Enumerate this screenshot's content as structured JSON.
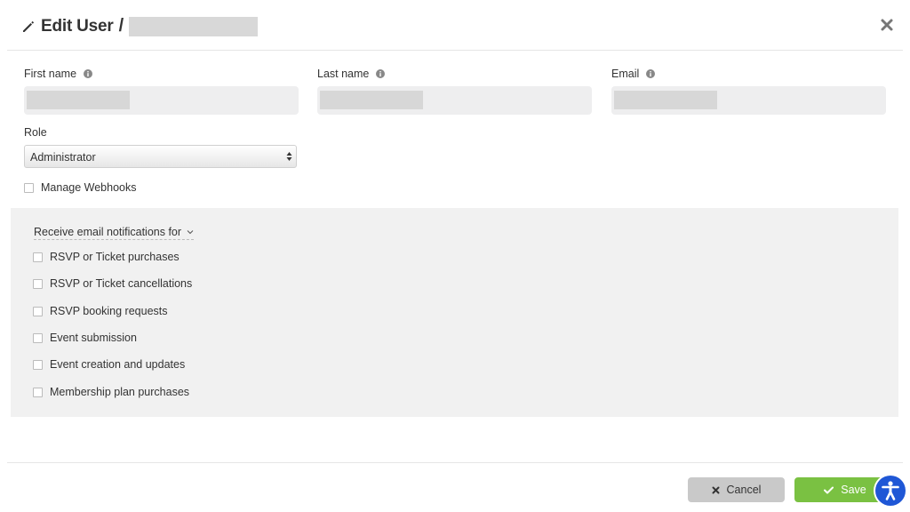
{
  "header": {
    "title": "Edit User",
    "separator": "/"
  },
  "form": {
    "first_name": {
      "label": "First name",
      "value": ""
    },
    "last_name": {
      "label": "Last name",
      "value": ""
    },
    "email": {
      "label": "Email",
      "value": ""
    },
    "role": {
      "label": "Role",
      "selected": "Administrator"
    },
    "manage_webhooks": {
      "label": "Manage Webhooks",
      "checked": false
    }
  },
  "notifications": {
    "header": "Receive email notifications for",
    "items": [
      {
        "label": "RSVP or Ticket purchases",
        "checked": false
      },
      {
        "label": "RSVP or Ticket cancellations",
        "checked": false
      },
      {
        "label": "RSVP booking requests",
        "checked": false
      },
      {
        "label": "Event submission",
        "checked": false
      },
      {
        "label": "Event creation and updates",
        "checked": false
      },
      {
        "label": "Membership plan purchases",
        "checked": false
      }
    ]
  },
  "footer": {
    "cancel_label": "Cancel",
    "save_label": "Save"
  },
  "colors": {
    "save": "#7ac142",
    "cancel": "#c9c9c9",
    "accessibility": "#1f57d6",
    "panel": "#f1f1f1"
  },
  "icons": {
    "title": "pencil-icon",
    "close": "close-icon",
    "info": "info-icon",
    "accessibility": "accessibility-icon"
  }
}
